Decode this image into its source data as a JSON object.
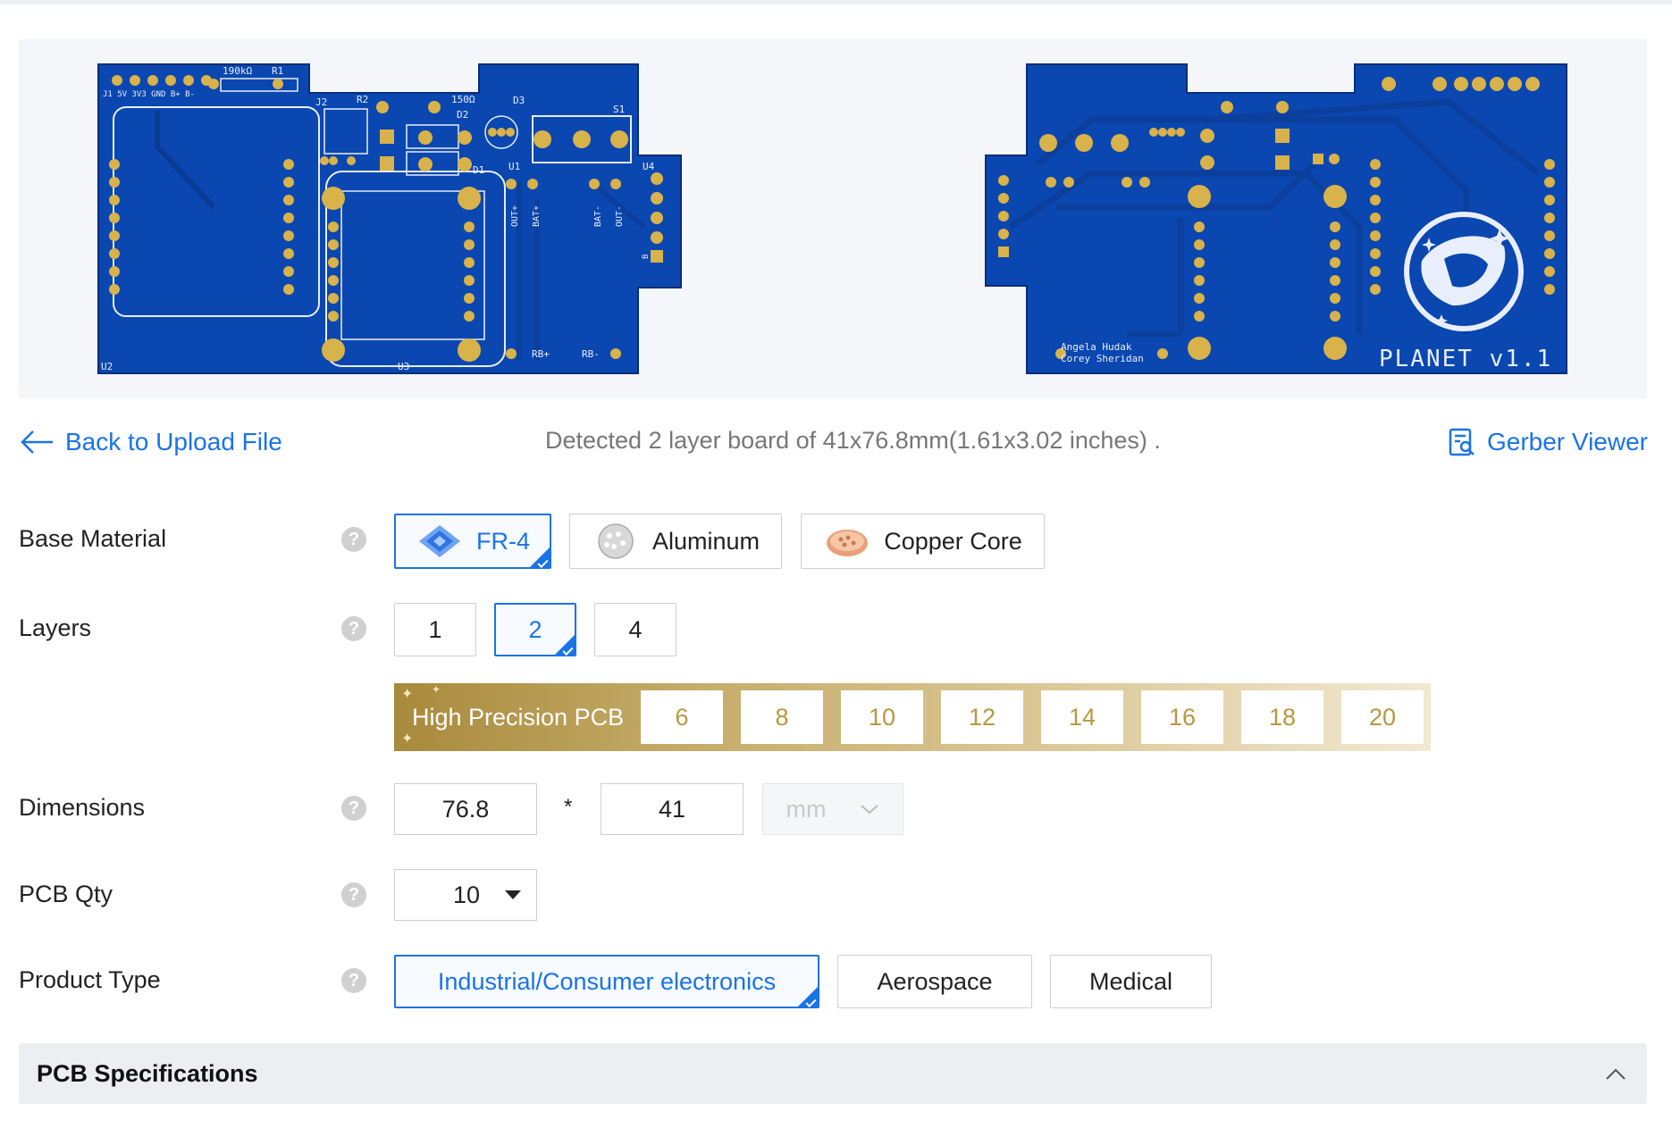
{
  "nav": {
    "back_label": "Back to Upload File",
    "detected_text": "Detected 2 layer board of 41x76.8mm(1.61x3.02 inches) .",
    "gerber_label": "Gerber Viewer"
  },
  "board_preview": {
    "pcb_color": "#0a47b0",
    "pad_color": "#d8b24a",
    "top_labels": {
      "r_label": "190kΩ",
      "r1": "R1",
      "r2": "R2",
      "r2_value": "150Ω",
      "j2": "J2",
      "d2": "D2",
      "d3": "D3",
      "s1": "S1",
      "d1": "D1",
      "u1": "U1",
      "u4": "U4",
      "u2": "U2",
      "u3": "U3",
      "header_pins": "J1 5V 3V3 GND B+ B-",
      "out_plus": "OUT+",
      "bat_plus": "BAT+",
      "bat_minus": "BAT-",
      "out_minus": "OUT-",
      "b_plus": "B",
      "rb_plus": "RB+",
      "rb_minus": "RB-"
    },
    "bottom_labels": {
      "author1": "Angela Hudak",
      "author2": "Corey Sheridan",
      "version": "PLANET v1.1"
    }
  },
  "form": {
    "base_material": {
      "label": "Base Material",
      "options": [
        "FR-4",
        "Aluminum",
        "Copper Core"
      ],
      "selected": "FR-4"
    },
    "layers": {
      "label": "Layers",
      "options": [
        "1",
        "2",
        "4"
      ],
      "selected": "2"
    },
    "high_precision": {
      "label": "High Precision PCB",
      "options": [
        "6",
        "8",
        "10",
        "12",
        "14",
        "16",
        "18",
        "20"
      ]
    },
    "dimensions": {
      "label": "Dimensions",
      "length": "76.8",
      "times": "*",
      "width": "41",
      "unit": "mm"
    },
    "qty": {
      "label": "PCB Qty",
      "value": "10"
    },
    "product_type": {
      "label": "Product Type",
      "options": [
        "Industrial/Consumer electronics",
        "Aerospace",
        "Medical"
      ],
      "selected": "Industrial/Consumer electronics"
    },
    "help_glyph": "?"
  },
  "specs": {
    "title": "PCB Specifications"
  },
  "colors": {
    "accent": "#1a73e8",
    "gold": "#b8973f"
  }
}
